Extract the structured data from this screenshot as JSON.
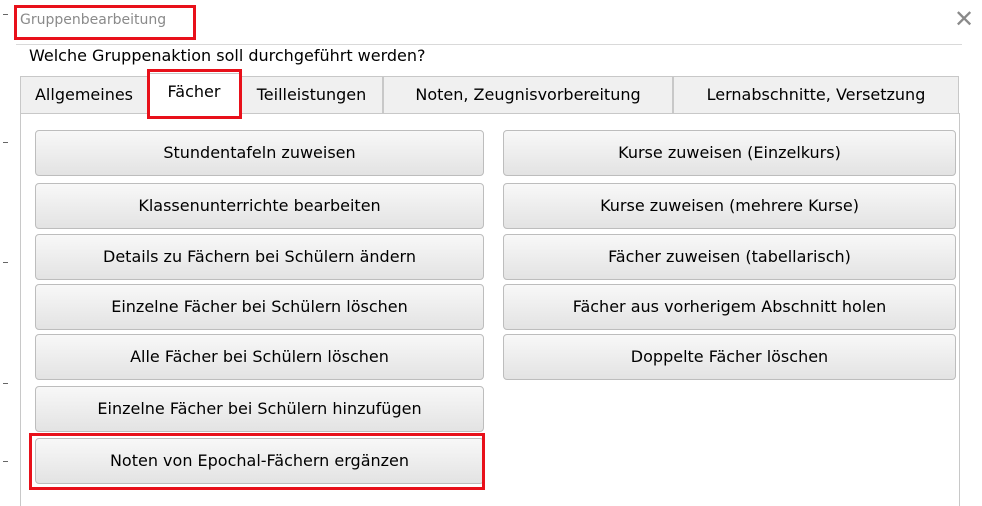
{
  "window": {
    "title": "Gruppenbearbeitung"
  },
  "question": "Welche Gruppenaktion soll durchgeführt werden?",
  "tabs": [
    {
      "label": "Allgemeines"
    },
    {
      "label": "Fächer"
    },
    {
      "label": "Teilleistungen"
    },
    {
      "label": "Noten, Zeugnisvorbereitung"
    },
    {
      "label": "Lernabschnitte, Versetzung"
    }
  ],
  "active_tab": "Fächer",
  "left_buttons": [
    {
      "label": "Stundentafeln zuweisen"
    },
    {
      "label": "Klassenunterrichte bearbeiten"
    },
    {
      "label": "Details zu Fächern bei Schülern ändern"
    },
    {
      "label": "Einzelne Fächer bei Schülern löschen"
    },
    {
      "label": "Alle Fächer bei Schülern löschen"
    },
    {
      "label": "Einzelne Fächer bei Schülern hinzufügen"
    },
    {
      "label": "Noten von Epochal-Fächern ergänzen"
    }
  ],
  "right_buttons": [
    {
      "label": "Kurse zuweisen (Einzelkurs)"
    },
    {
      "label": "Kurse zuweisen (mehrere Kurse)"
    },
    {
      "label": "Fächer zuweisen (tabellarisch)"
    },
    {
      "label": "Fächer aus vorherigem Abschnitt holen"
    },
    {
      "label": "Doppelte Fächer löschen"
    }
  ],
  "colors": {
    "highlight": "#e8101a",
    "button_bg": "#e8e8e8",
    "title_text": "#8a8a8a"
  },
  "icons": {
    "close": "close-icon"
  }
}
